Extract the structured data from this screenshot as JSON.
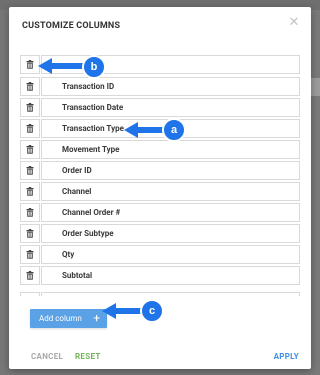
{
  "dialog": {
    "title": "CUSTOMIZE COLUMNS",
    "close_icon": "close-icon"
  },
  "columns": [
    {
      "label": ""
    },
    {
      "label": "Transaction ID"
    },
    {
      "label": "Transaction Date"
    },
    {
      "label": "Transaction Type"
    },
    {
      "label": "Movement Type"
    },
    {
      "label": "Order ID"
    },
    {
      "label": "Channel"
    },
    {
      "label": "Channel Order #"
    },
    {
      "label": "Order Subtype"
    },
    {
      "label": "Qty"
    },
    {
      "label": "Subtotal"
    }
  ],
  "add_column": {
    "label": "Add column",
    "icon": "plus-icon"
  },
  "footer": {
    "cancel": "CANCEL",
    "reset": "RESET",
    "apply": "APPLY"
  },
  "callouts": {
    "a": "a",
    "b": "b",
    "c": "c"
  },
  "colors": {
    "accent": "#1e74e8",
    "button": "#5aa1e6",
    "reset": "#74b45b",
    "apply": "#3d8ee6"
  }
}
